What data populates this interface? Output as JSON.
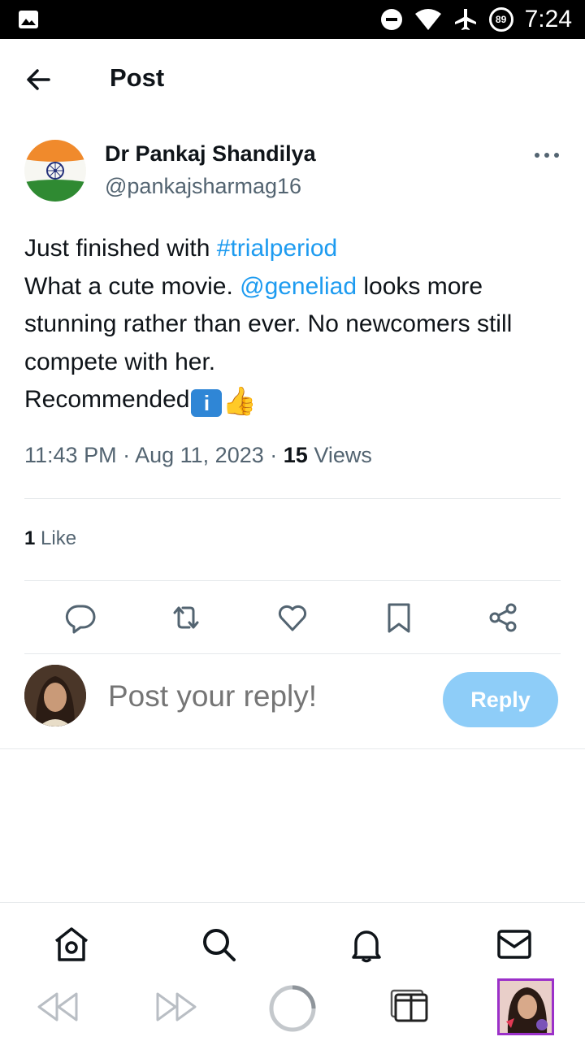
{
  "status_bar": {
    "time": "7:24",
    "battery": "89"
  },
  "header": {
    "title": "Post"
  },
  "author": {
    "name": "Dr Pankaj Shandilya",
    "handle": "@pankajsharmag16"
  },
  "post": {
    "line1_text": "Just finished with ",
    "hashtag": "#trialperiod",
    "line2_text": "What a cute movie. ",
    "mention": "@geneliad",
    "line2_rest": " looks more stunning rather than ever. No newcomers still compete with her.",
    "line3_text": "Recommended",
    "info_emoji": "i",
    "thumb_emoji": "👍"
  },
  "meta": {
    "time": "11:43 PM",
    "date": "Aug 11, 2023",
    "views_count": "15",
    "views_label": "Views",
    "sep": "·"
  },
  "stats": {
    "likes_count": "1",
    "likes_label": "Like"
  },
  "reply": {
    "placeholder": "Post your reply!",
    "button_label": "Reply"
  },
  "colors": {
    "accent": "#1d9bf0",
    "reply_button": "#8ecdf8",
    "muted": "#536471"
  }
}
